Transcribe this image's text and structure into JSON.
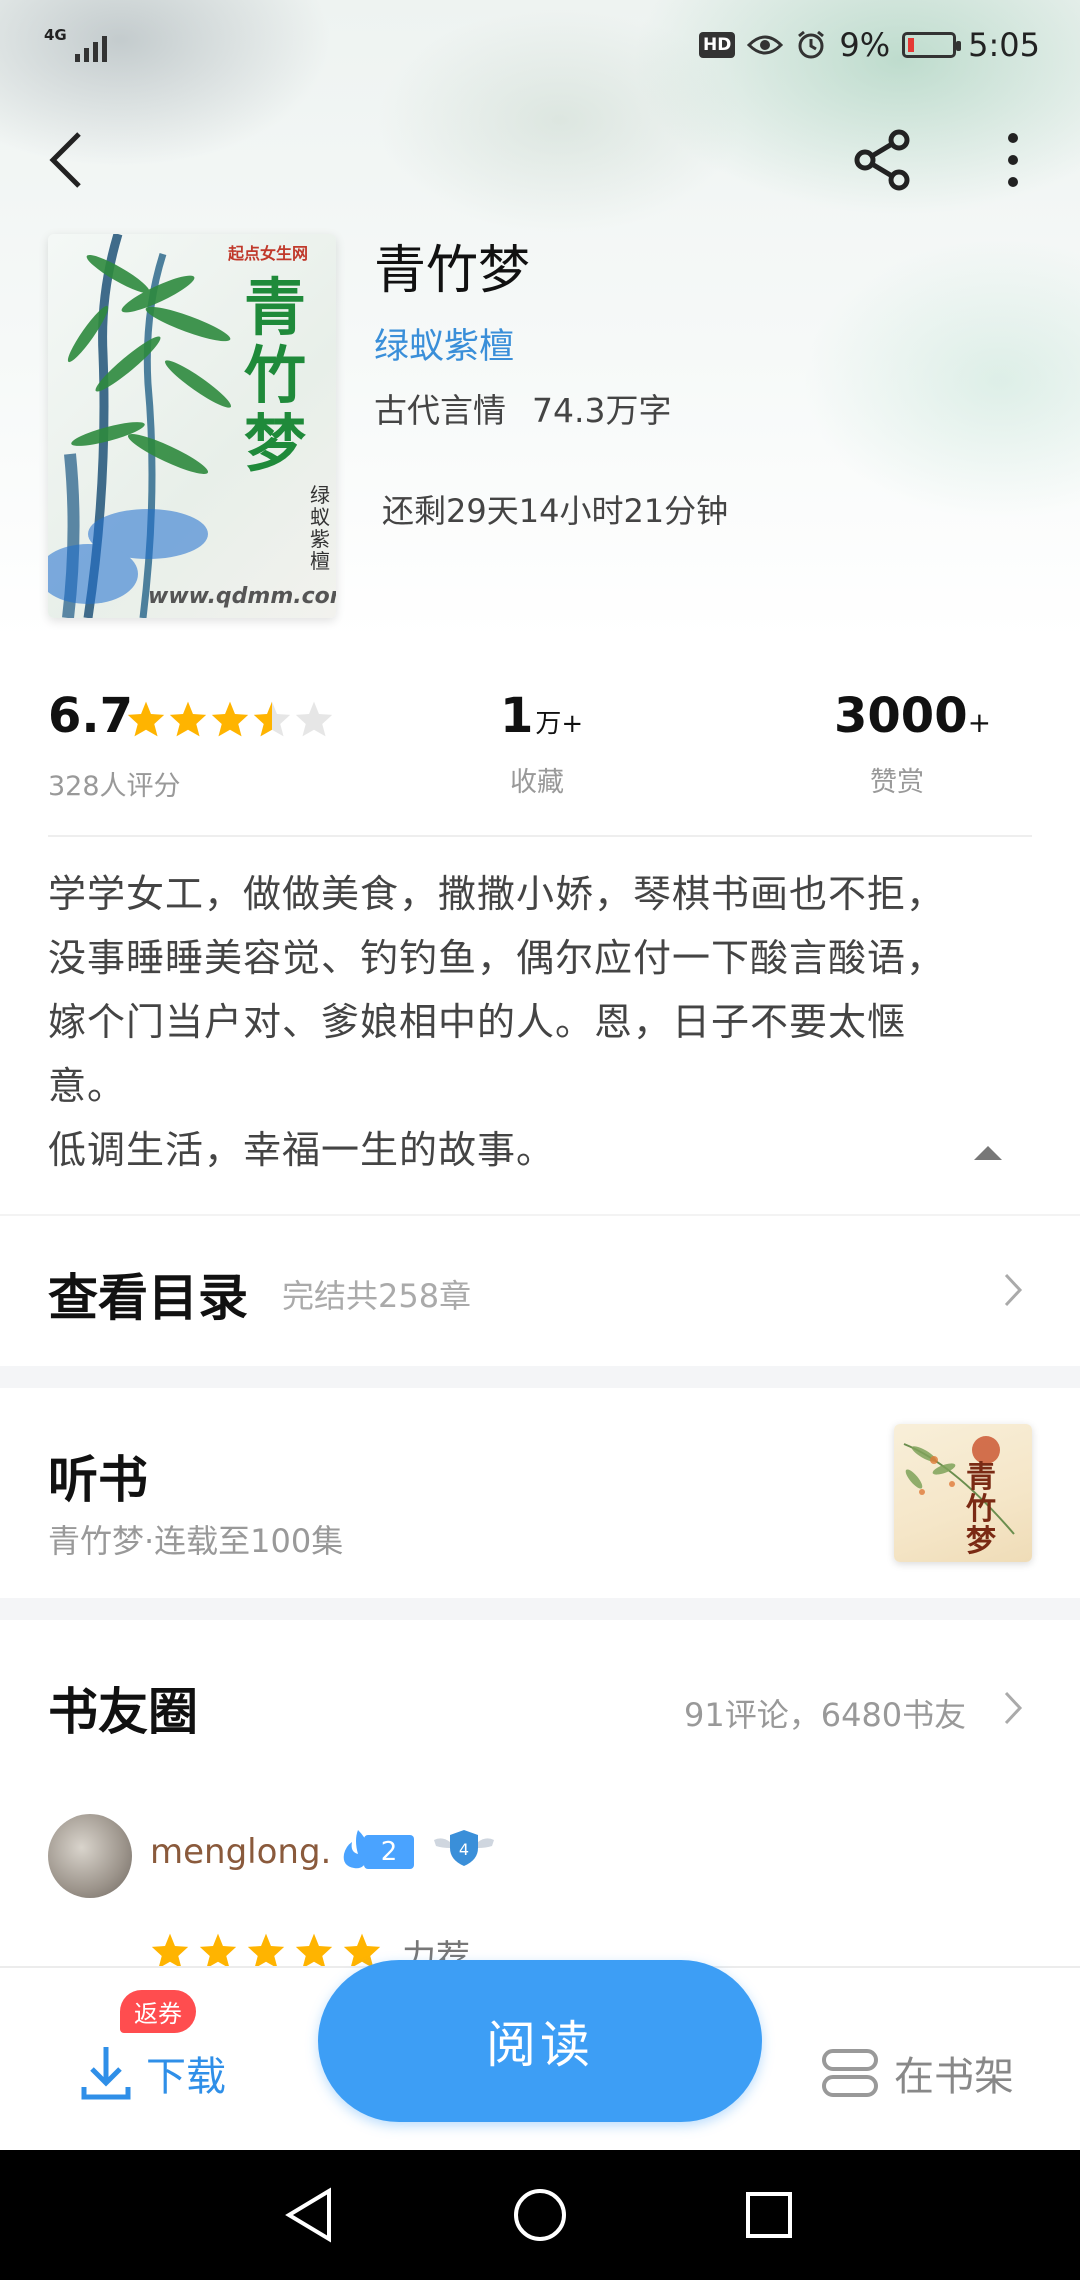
{
  "status_bar": {
    "network": "4G",
    "battery": "9%",
    "time": "5:05",
    "hd": "HD"
  },
  "book": {
    "title": "青竹梦",
    "author": "绿蚁紫檀",
    "genre": "古代言情",
    "word_count": "74.3万字",
    "countdown": "还剩29天14小时21分钟",
    "cover_title": "青竹梦",
    "cover_author": "绿蚁紫檀",
    "cover_site": "www.qdmm.com",
    "cover_publisher": "起点女生网"
  },
  "stats": {
    "rating": "6.7",
    "rating_stars": 3.5,
    "rating_count": "328人评分",
    "favorites_value": "1",
    "favorites_unit": "万+",
    "favorites_label": "收藏",
    "rewards_value": "3000",
    "rewards_plus": "+",
    "rewards_label": "赞赏"
  },
  "description": {
    "lines": [
      "学学女工，做做美食，撒撒小娇，琴棋书画也不拒，",
      "没事睡睡美容觉、钓钓鱼，偶尔应付一下酸言酸语，",
      "嫁个门当户对、爹娘相中的人。恩，日子不要太惬",
      "意。",
      "低调生活，幸福一生的故事。"
    ]
  },
  "catalog": {
    "title": "查看目录",
    "subtitle": "完结共258章"
  },
  "audiobook": {
    "title": "听书",
    "subtitle": "青竹梦·连载至100集",
    "cover_title": "青竹梦"
  },
  "community": {
    "title": "书友圈",
    "stats": "91评论，6480书友",
    "review": {
      "username": "menglong.",
      "fan_level": "2",
      "shield_level": "4",
      "stars": 5,
      "tag": "力荐"
    }
  },
  "actions": {
    "coupon": "返券",
    "download": "下载",
    "read": "阅读",
    "shelf": "在书架"
  },
  "colors": {
    "accent": "#3d9ef5",
    "author_link": "#3a8fd9",
    "star": "#ffb400",
    "coupon": "#ff4d4f"
  }
}
